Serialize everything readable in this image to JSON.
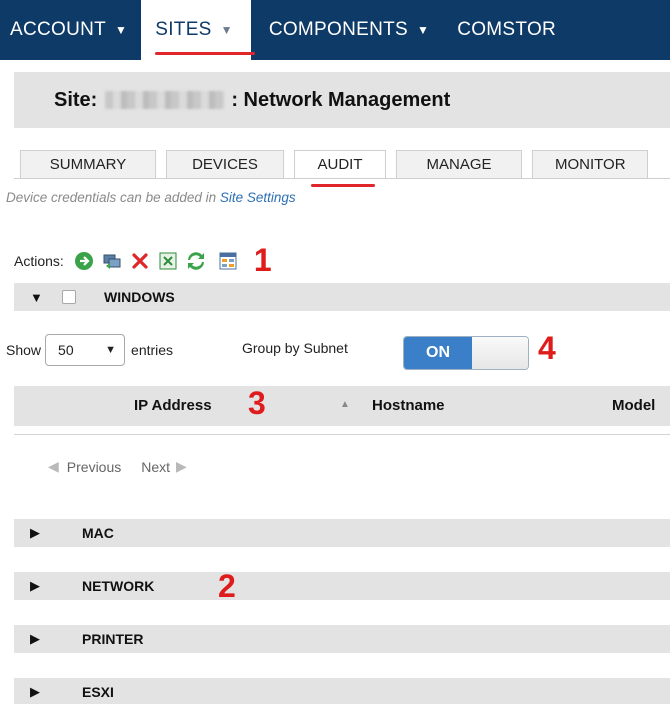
{
  "nav": {
    "items": [
      {
        "label": "ACCOUNT"
      },
      {
        "label": "SITES"
      },
      {
        "label": "COMPONENTS"
      },
      {
        "label": "COMSTOR"
      }
    ]
  },
  "site": {
    "prefix": "Site:",
    "suffix": ": Network Management"
  },
  "tabs": [
    {
      "label": "SUMMARY"
    },
    {
      "label": "DEVICES"
    },
    {
      "label": "AUDIT"
    },
    {
      "label": "MANAGE"
    },
    {
      "label": "MONITOR"
    }
  ],
  "hint": {
    "text": "Device credentials can be added in ",
    "link": "Site Settings"
  },
  "actions": {
    "label": "Actions:",
    "icons": [
      "go-arrow-icon",
      "computer-transfer-icon",
      "delete-x-icon",
      "excel-export-icon",
      "refresh-icon",
      "grid-columns-icon"
    ]
  },
  "annotations": {
    "n1": "1",
    "n2": "2",
    "n3": "3",
    "n4": "4"
  },
  "groups": {
    "windows": "WINDOWS",
    "mac": "MAC",
    "network": "NETWORK",
    "printer": "PRINTER",
    "esxi": "ESXI"
  },
  "entries": {
    "show": "Show",
    "value": "50",
    "suffix": "entries"
  },
  "group_by": {
    "label": "Group by Subnet",
    "state": "ON"
  },
  "table": {
    "columns": [
      "IP Address",
      "Hostname",
      "Model"
    ]
  },
  "pager": {
    "previous": "Previous",
    "next": "Next"
  },
  "colors": {
    "nav_bg": "#0e3a68",
    "accent_red": "#e0262b",
    "toggle_on": "#3a7fc8",
    "link": "#2c6fb4"
  }
}
